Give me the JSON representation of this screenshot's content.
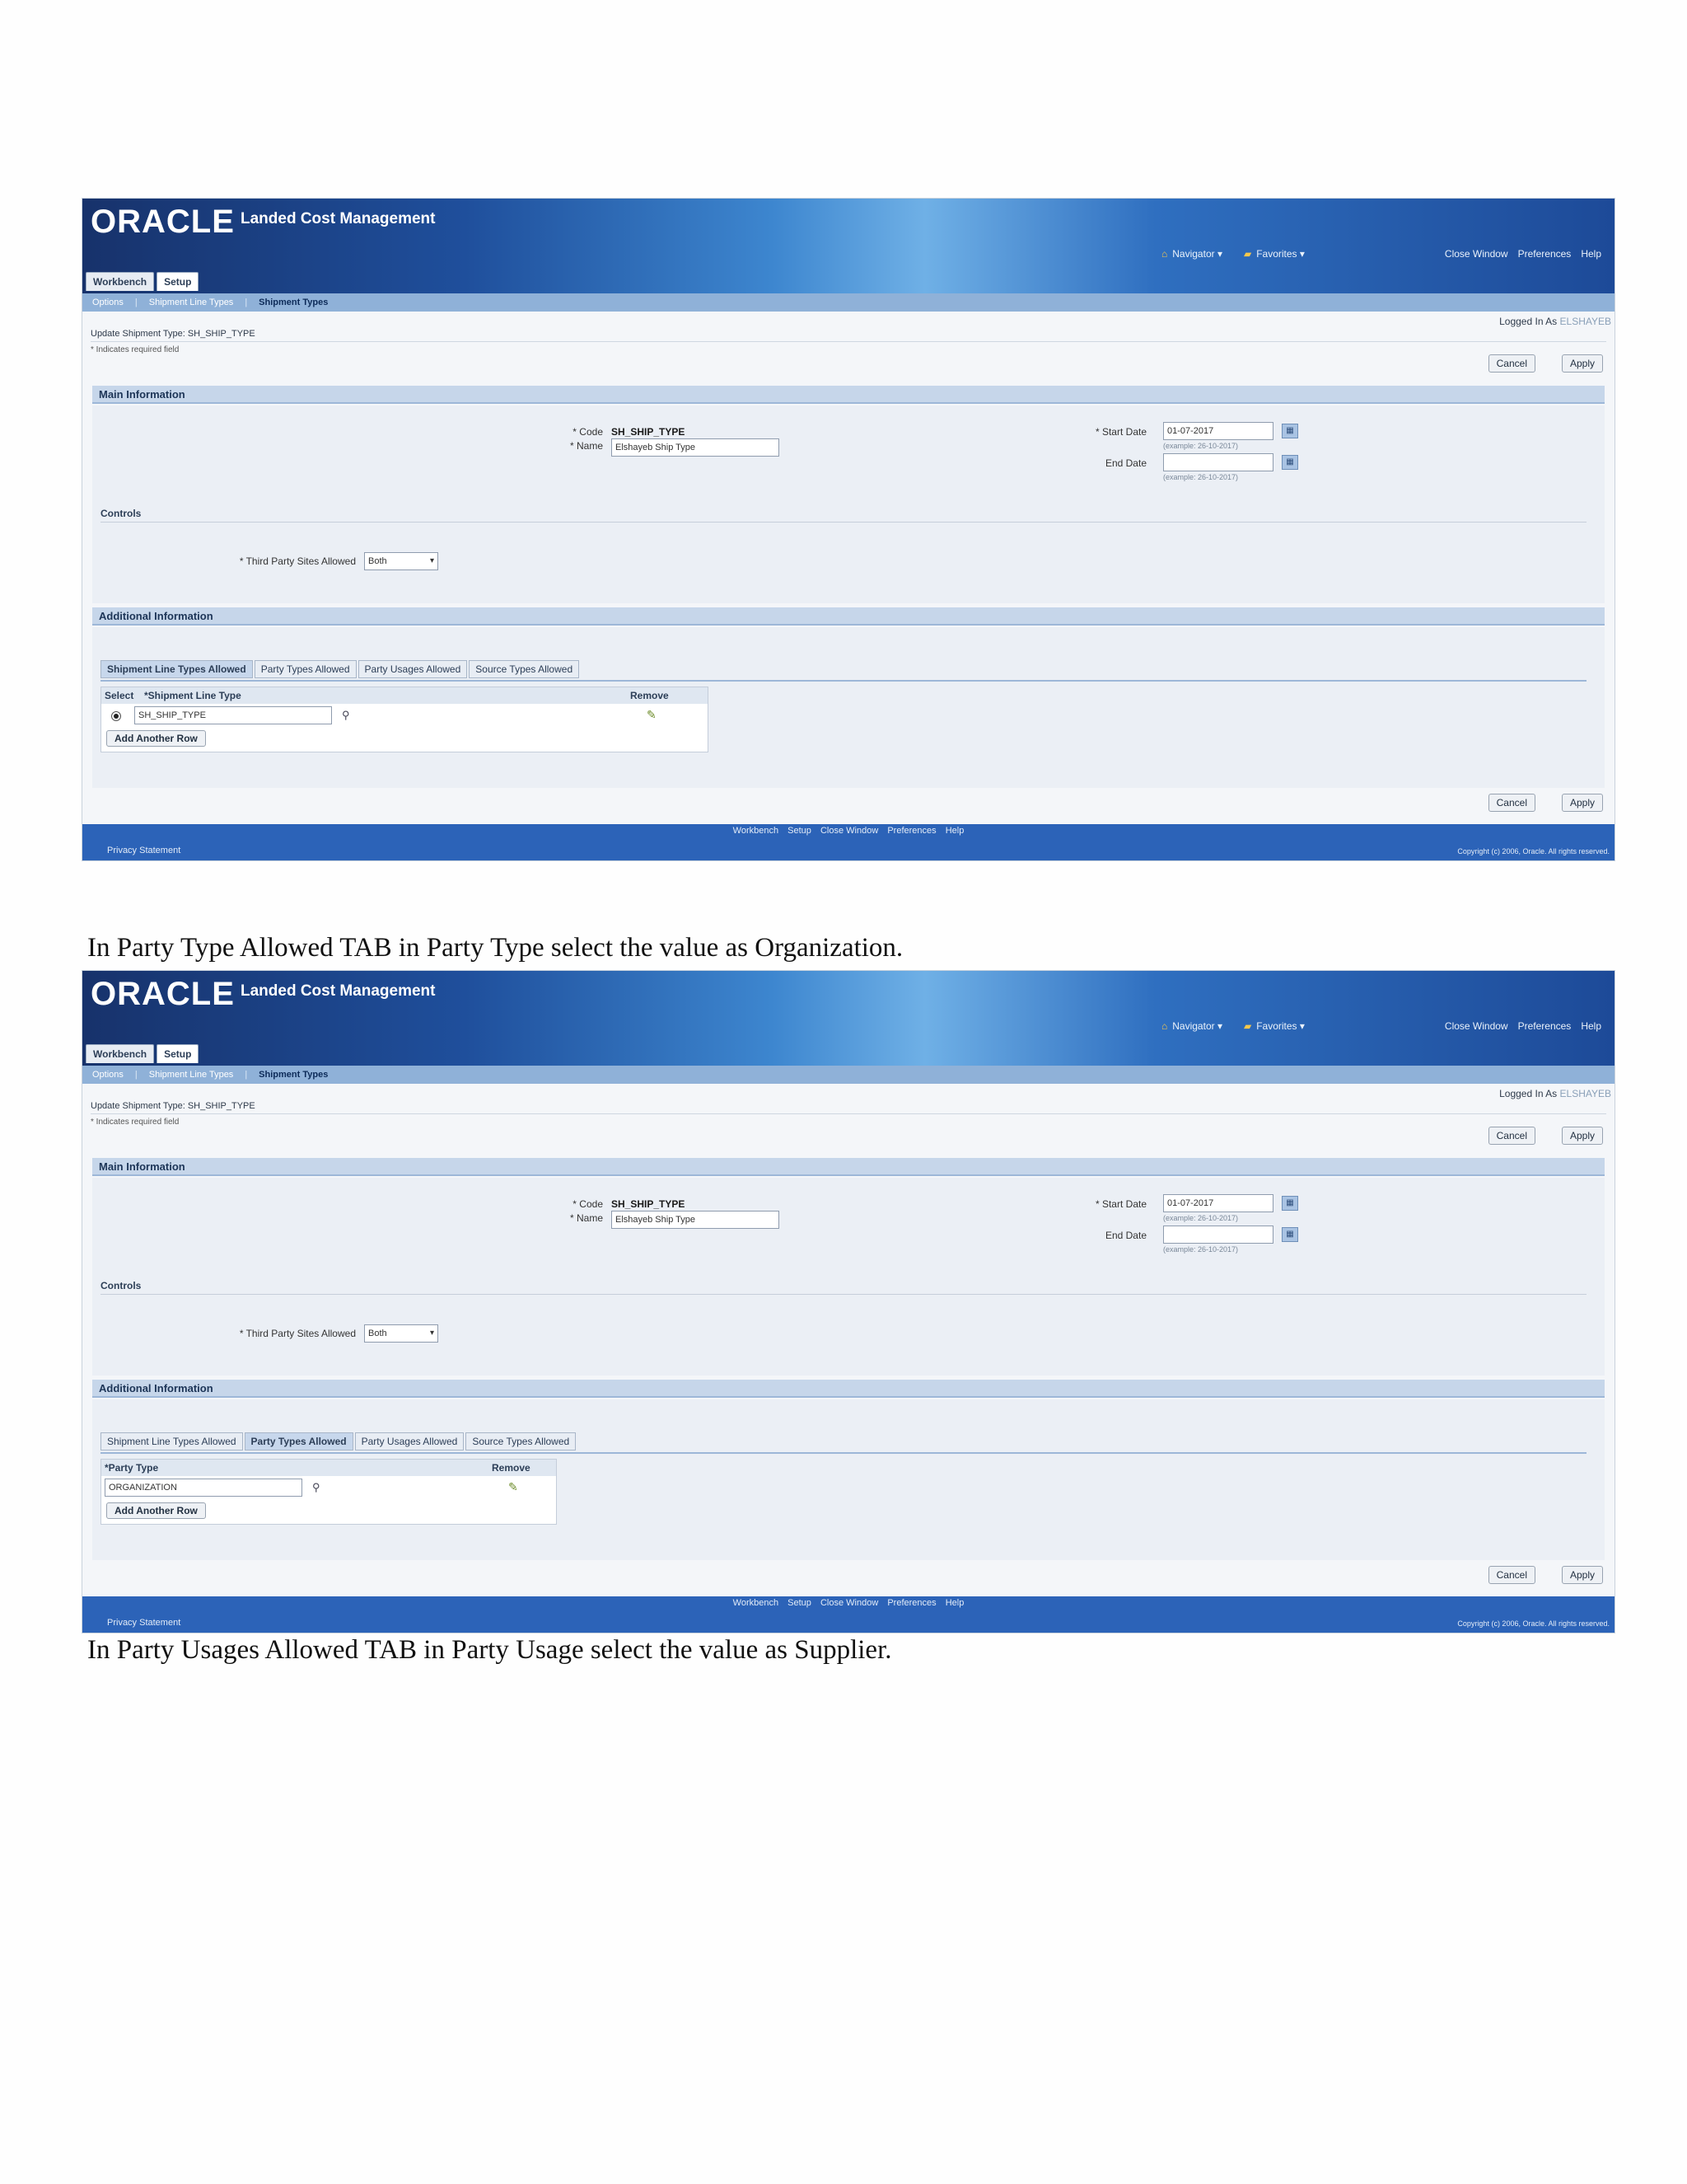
{
  "app": {
    "logo": "ORACLE",
    "name": "Landed Cost Management",
    "navigator": "Navigator",
    "favorites": "Favorites",
    "global_links": [
      "Close Window",
      "Preferences",
      "Help"
    ],
    "tabs": [
      "Workbench",
      "Setup"
    ],
    "subnav": [
      "Options",
      "Shipment Line Types",
      "Shipment Types"
    ],
    "logged_in_label": "Logged In As",
    "logged_in_user": "ELSHAYEB",
    "page_title": "Update Shipment Type: SH_SHIP_TYPE",
    "required_note": "* Indicates required field",
    "cancel_label": "Cancel",
    "apply_label": "Apply",
    "main_info_header": "Main Information",
    "code_label": "* Code",
    "code_value": "SH_SHIP_TYPE",
    "name_label": "* Name",
    "name_value": "Elshayeb Ship Type",
    "start_date_label": "* Start Date",
    "start_date_value": "01-07-2017",
    "date_example": "(example: 26-10-2017)",
    "end_date_label": "End Date",
    "end_date_value": "",
    "controls_title": "Controls",
    "third_party_label": "* Third Party Sites Allowed",
    "third_party_value": "Both",
    "additional_header": "Additional Information",
    "subtabs": [
      "Shipment Line Types Allowed",
      "Party Types Allowed",
      "Party Usages Allowed",
      "Source Types Allowed"
    ],
    "add_row_label": "Add Another Row",
    "footer_links": [
      "Workbench",
      "Setup",
      "Close Window",
      "Preferences",
      "Help"
    ],
    "privacy": "Privacy Statement",
    "copyright": "Copyright (c) 2006, Oracle. All rights reserved."
  },
  "shot1": {
    "table": {
      "select_header": "Select",
      "col_header": "*Shipment Line Type",
      "remove_header": "Remove",
      "value": "SH_SHIP_TYPE"
    }
  },
  "shot2": {
    "table": {
      "col_header": "*Party Type",
      "remove_header": "Remove",
      "value": "ORGANIZATION"
    }
  },
  "captions": {
    "first": "In Party Type Allowed TAB in Party Type select the value as Organization.",
    "second": "In Party Usages Allowed TAB in Party Usage select the value as Supplier."
  }
}
